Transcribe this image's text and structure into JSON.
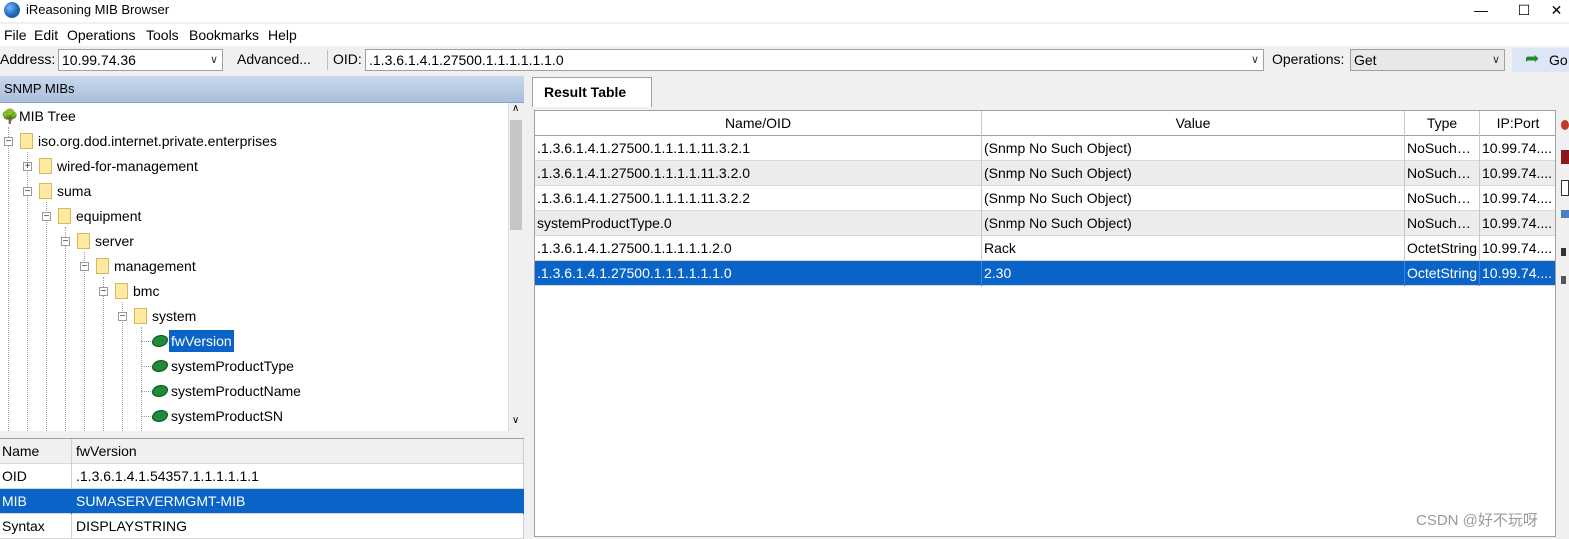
{
  "window": {
    "title": "iReasoning MIB Browser",
    "minimize": "—",
    "maximize": "☐",
    "close": "✕"
  },
  "menu": [
    "File",
    "Edit",
    "Operations",
    "Tools",
    "Bookmarks",
    "Help"
  ],
  "addressbar": {
    "address_label": "Address:",
    "address_value": "10.99.74.36",
    "advanced_label": "Advanced...",
    "oid_label": "OID:",
    "oid_value": ".1.3.6.1.4.1.27500.1.1.1.1.1.1.0",
    "operations_label": "Operations:",
    "operations_value": "Get",
    "go_label": "Go"
  },
  "left_pane": {
    "header": "SNMP MIBs",
    "tree": [
      {
        "label": "MIB Tree",
        "icon": "tree-icon"
      },
      {
        "label": "iso.org.dod.internet.private.enterprises",
        "icon": "folder-icon"
      },
      {
        "label": "wired-for-management",
        "icon": "folder-icon"
      },
      {
        "label": "suma",
        "icon": "folder-icon"
      },
      {
        "label": "equipment",
        "icon": "folder-icon"
      },
      {
        "label": "server",
        "icon": "folder-icon"
      },
      {
        "label": "management",
        "icon": "folder-icon"
      },
      {
        "label": "bmc",
        "icon": "folder-icon"
      },
      {
        "label": "system",
        "icon": "folder-icon"
      },
      {
        "label": "fwVersion",
        "icon": "leaf-icon",
        "selected": true
      },
      {
        "label": "systemProductType",
        "icon": "leaf-icon"
      },
      {
        "label": "systemProductName",
        "icon": "leaf-icon"
      },
      {
        "label": "systemProductSN",
        "icon": "leaf-icon"
      }
    ],
    "properties": {
      "header": [
        "Name",
        "fwVersion"
      ],
      "rows": [
        [
          "OID",
          ".1.3.6.1.4.1.54357.1.1.1.1.1.1"
        ],
        [
          "MIB",
          "SUMASERVERMGMT-MIB"
        ],
        [
          "Syntax",
          "DISPLAYSTRING"
        ]
      ]
    }
  },
  "result_table": {
    "tab_label": "Result Table",
    "columns": [
      "Name/OID",
      "Value",
      "Type",
      "IP:Port"
    ],
    "rows": [
      [
        ".1.3.6.1.4.1.27500.1.1.1.1.11.3.2.1",
        "(Snmp No Such Object)",
        "NoSuchO...",
        "10.99.74...."
      ],
      [
        ".1.3.6.1.4.1.27500.1.1.1.1.11.3.2.0",
        "(Snmp No Such Object)",
        "NoSuchO...",
        "10.99.74...."
      ],
      [
        ".1.3.6.1.4.1.27500.1.1.1.1.11.3.2.2",
        "(Snmp No Such Object)",
        "NoSuchO...",
        "10.99.74...."
      ],
      [
        "systemProductType.0",
        "(Snmp No Such Object)",
        "NoSuchO...",
        "10.99.74...."
      ],
      [
        ".1.3.6.1.4.1.27500.1.1.1.1.1.2.0",
        "Rack",
        "OctetString",
        "10.99.74...."
      ],
      [
        ".1.3.6.1.4.1.27500.1.1.1.1.1.1.0",
        "2.30",
        "OctetString",
        "10.99.74...."
      ]
    ],
    "selected_row": 5
  },
  "watermark": "CSDN @好不玩呀",
  "colors": {
    "selection": "#0a64c8",
    "header_gradient": "#a9bfdc"
  }
}
